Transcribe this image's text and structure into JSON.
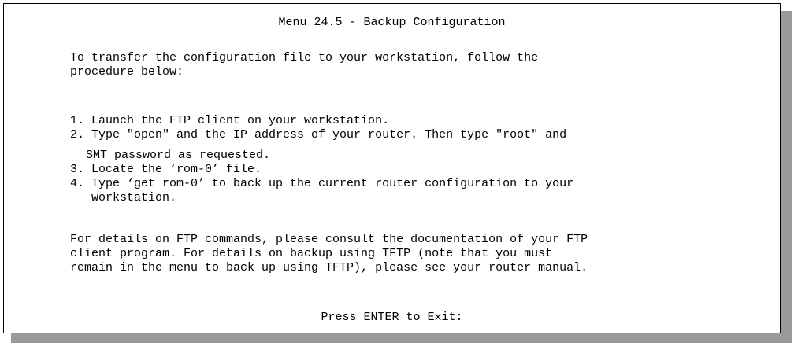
{
  "screen": {
    "title": "Menu 24.5 - Backup Configuration",
    "intro": "To transfer the configuration file to your workstation, follow the\nprocedure below:",
    "steps": [
      "1. Launch the FTP client on your workstation.",
      "2. Type \"open\" and the IP address of your router. Then type \"root\" and",
      "SMT password as requested.",
      "3. Locate the ‘rom-0’ file.",
      "4. Type ‘get rom-0’ to back up the current router configuration to your\n   workstation."
    ],
    "details": "For details on FTP commands, please consult the documentation of your FTP\nclient program. For details on backup using TFTP (note that you must\nremain in the menu to back up using TFTP), please see your router manual.",
    "prompt": "Press ENTER to Exit:"
  }
}
